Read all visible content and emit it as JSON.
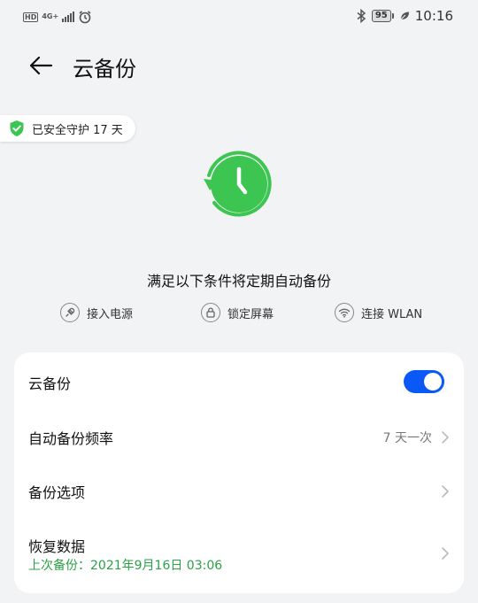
{
  "status_bar": {
    "hd": "HD",
    "network": "4G+",
    "battery": "95",
    "time": "10:16"
  },
  "header": {
    "title": "云备份"
  },
  "guard": {
    "text": "已安全守护 17 天"
  },
  "conditions": {
    "title": "满足以下条件将定期自动备份",
    "items": [
      {
        "label": "接入电源",
        "icon": "plug-icon"
      },
      {
        "label": "锁定屏幕",
        "icon": "lock-icon"
      },
      {
        "label": "连接 WLAN",
        "icon": "wifi-icon"
      }
    ]
  },
  "settings": {
    "cloud_backup": {
      "label": "云备份",
      "enabled": true
    },
    "frequency": {
      "label": "自动备份频率",
      "value": "7 天一次"
    },
    "options": {
      "label": "备份选项"
    },
    "restore": {
      "label": "恢复数据",
      "last_backup": "上次备份：2021年9月16日 03:06"
    }
  },
  "colors": {
    "accent_blue": "#0a59f7",
    "green": "#3cc651",
    "success_text": "#2aa144"
  }
}
